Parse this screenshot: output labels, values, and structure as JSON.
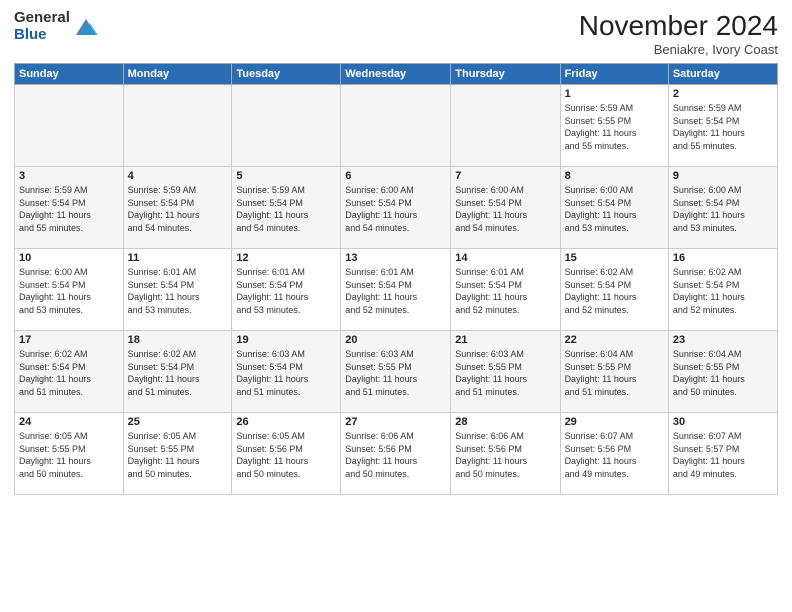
{
  "header": {
    "logo_line1": "General",
    "logo_line2": "Blue",
    "month_year": "November 2024",
    "location": "Beniakre, Ivory Coast"
  },
  "weekdays": [
    "Sunday",
    "Monday",
    "Tuesday",
    "Wednesday",
    "Thursday",
    "Friday",
    "Saturday"
  ],
  "weeks": [
    [
      {
        "day": "",
        "info": ""
      },
      {
        "day": "",
        "info": ""
      },
      {
        "day": "",
        "info": ""
      },
      {
        "day": "",
        "info": ""
      },
      {
        "day": "",
        "info": ""
      },
      {
        "day": "1",
        "info": "Sunrise: 5:59 AM\nSunset: 5:55 PM\nDaylight: 11 hours\nand 55 minutes."
      },
      {
        "day": "2",
        "info": "Sunrise: 5:59 AM\nSunset: 5:54 PM\nDaylight: 11 hours\nand 55 minutes."
      }
    ],
    [
      {
        "day": "3",
        "info": "Sunrise: 5:59 AM\nSunset: 5:54 PM\nDaylight: 11 hours\nand 55 minutes."
      },
      {
        "day": "4",
        "info": "Sunrise: 5:59 AM\nSunset: 5:54 PM\nDaylight: 11 hours\nand 54 minutes."
      },
      {
        "day": "5",
        "info": "Sunrise: 5:59 AM\nSunset: 5:54 PM\nDaylight: 11 hours\nand 54 minutes."
      },
      {
        "day": "6",
        "info": "Sunrise: 6:00 AM\nSunset: 5:54 PM\nDaylight: 11 hours\nand 54 minutes."
      },
      {
        "day": "7",
        "info": "Sunrise: 6:00 AM\nSunset: 5:54 PM\nDaylight: 11 hours\nand 54 minutes."
      },
      {
        "day": "8",
        "info": "Sunrise: 6:00 AM\nSunset: 5:54 PM\nDaylight: 11 hours\nand 53 minutes."
      },
      {
        "day": "9",
        "info": "Sunrise: 6:00 AM\nSunset: 5:54 PM\nDaylight: 11 hours\nand 53 minutes."
      }
    ],
    [
      {
        "day": "10",
        "info": "Sunrise: 6:00 AM\nSunset: 5:54 PM\nDaylight: 11 hours\nand 53 minutes."
      },
      {
        "day": "11",
        "info": "Sunrise: 6:01 AM\nSunset: 5:54 PM\nDaylight: 11 hours\nand 53 minutes."
      },
      {
        "day": "12",
        "info": "Sunrise: 6:01 AM\nSunset: 5:54 PM\nDaylight: 11 hours\nand 53 minutes."
      },
      {
        "day": "13",
        "info": "Sunrise: 6:01 AM\nSunset: 5:54 PM\nDaylight: 11 hours\nand 52 minutes."
      },
      {
        "day": "14",
        "info": "Sunrise: 6:01 AM\nSunset: 5:54 PM\nDaylight: 11 hours\nand 52 minutes."
      },
      {
        "day": "15",
        "info": "Sunrise: 6:02 AM\nSunset: 5:54 PM\nDaylight: 11 hours\nand 52 minutes."
      },
      {
        "day": "16",
        "info": "Sunrise: 6:02 AM\nSunset: 5:54 PM\nDaylight: 11 hours\nand 52 minutes."
      }
    ],
    [
      {
        "day": "17",
        "info": "Sunrise: 6:02 AM\nSunset: 5:54 PM\nDaylight: 11 hours\nand 51 minutes."
      },
      {
        "day": "18",
        "info": "Sunrise: 6:02 AM\nSunset: 5:54 PM\nDaylight: 11 hours\nand 51 minutes."
      },
      {
        "day": "19",
        "info": "Sunrise: 6:03 AM\nSunset: 5:54 PM\nDaylight: 11 hours\nand 51 minutes."
      },
      {
        "day": "20",
        "info": "Sunrise: 6:03 AM\nSunset: 5:55 PM\nDaylight: 11 hours\nand 51 minutes."
      },
      {
        "day": "21",
        "info": "Sunrise: 6:03 AM\nSunset: 5:55 PM\nDaylight: 11 hours\nand 51 minutes."
      },
      {
        "day": "22",
        "info": "Sunrise: 6:04 AM\nSunset: 5:55 PM\nDaylight: 11 hours\nand 51 minutes."
      },
      {
        "day": "23",
        "info": "Sunrise: 6:04 AM\nSunset: 5:55 PM\nDaylight: 11 hours\nand 50 minutes."
      }
    ],
    [
      {
        "day": "24",
        "info": "Sunrise: 6:05 AM\nSunset: 5:55 PM\nDaylight: 11 hours\nand 50 minutes."
      },
      {
        "day": "25",
        "info": "Sunrise: 6:05 AM\nSunset: 5:55 PM\nDaylight: 11 hours\nand 50 minutes."
      },
      {
        "day": "26",
        "info": "Sunrise: 6:05 AM\nSunset: 5:56 PM\nDaylight: 11 hours\nand 50 minutes."
      },
      {
        "day": "27",
        "info": "Sunrise: 6:06 AM\nSunset: 5:56 PM\nDaylight: 11 hours\nand 50 minutes."
      },
      {
        "day": "28",
        "info": "Sunrise: 6:06 AM\nSunset: 5:56 PM\nDaylight: 11 hours\nand 50 minutes."
      },
      {
        "day": "29",
        "info": "Sunrise: 6:07 AM\nSunset: 5:56 PM\nDaylight: 11 hours\nand 49 minutes."
      },
      {
        "day": "30",
        "info": "Sunrise: 6:07 AM\nSunset: 5:57 PM\nDaylight: 11 hours\nand 49 minutes."
      }
    ]
  ]
}
